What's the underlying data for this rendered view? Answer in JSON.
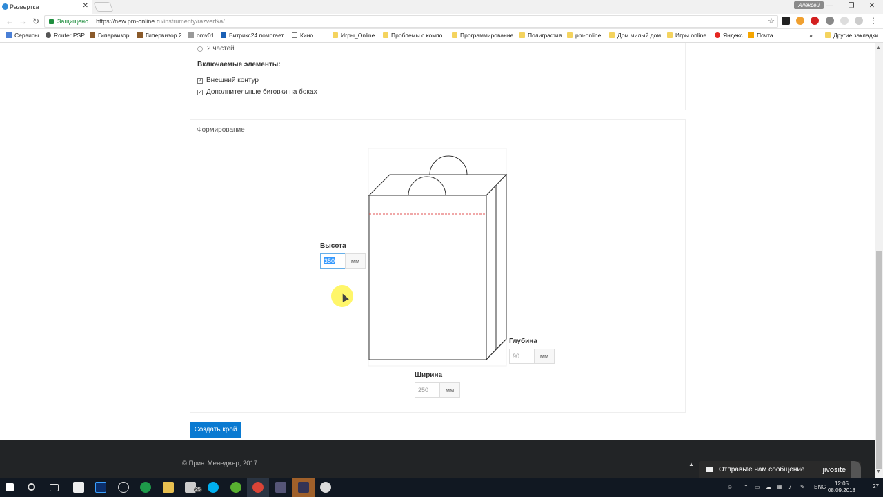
{
  "browser": {
    "tab_title": "Развертка",
    "tab_close": "✕",
    "user_name": "Алексей",
    "win_min": "—",
    "win_restore": "❐",
    "win_close": "✕",
    "back": "←",
    "forward": "→",
    "reload": "↻",
    "secure_label": "Защищено",
    "url_host": "https://new.pm-online.ru",
    "url_path": "/instrumenty/razvertka/",
    "star": "☆",
    "menu": "⋮"
  },
  "bookmarks": {
    "apps": "Сервисы",
    "items": [
      "Router PSP",
      "Гипервизор",
      "Гипервизор 2",
      "omv01",
      "Битрикс24 помогает",
      "Кино",
      "Игры_Online",
      "Проблемы с компо",
      "Программирование",
      "Полиграфия",
      "pm-online",
      "Дом милый дом",
      "Игры online",
      "Яндекс",
      "Почта"
    ],
    "more": "»",
    "other": "Другие закладки"
  },
  "form": {
    "radio_parts": "2 частей",
    "included_heading": "Включаемые элементы:",
    "cb_outer_contour": "Внешний контур",
    "cb_side_creases": "Дополнительные биговки на боках",
    "section_title": "Формирование",
    "height_label": "Высота",
    "height_value": "350",
    "width_label": "Ширина",
    "width_value": "250",
    "depth_label": "Глубина",
    "depth_value": "90",
    "unit": "мм",
    "create_button": "Создать крой"
  },
  "footer": {
    "copyright": "© ПринтМенеджер, 2017",
    "up": "▲"
  },
  "chat": {
    "message": "Отправьте нам сообщение",
    "brand": "jivosite"
  },
  "taskbar": {
    "lang": "ENG",
    "time": "12:05",
    "date": "08.09.2018",
    "notifications": "27",
    "mail_badge": "25"
  },
  "colors": {
    "accent": "#0a7ad1",
    "fold_line": "#e05050"
  }
}
